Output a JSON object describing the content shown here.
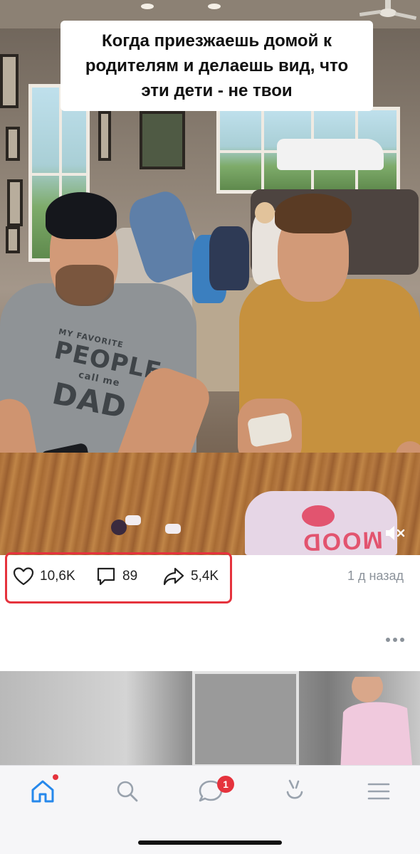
{
  "post": {
    "caption": "Когда приезжаешь домой к\nродителям и делаешь вид, что\nэти дети - не твои",
    "shirt_print": [
      "MY FAVORITE",
      "PEOPLE",
      "call me",
      "DAD"
    ],
    "bag_text": "MOOD",
    "actions": {
      "like_icon": "heart-icon",
      "like_count": "10,6K",
      "comment_icon": "comment-icon",
      "comment_count": "89",
      "share_icon": "share-arrow-icon",
      "share_count": "5,4K"
    },
    "timestamp": "1 д назад",
    "mute_icon": "speaker-muted-icon",
    "more_icon": "more-dots-icon"
  },
  "bottom_nav": {
    "items": [
      {
        "icon": "home-icon",
        "active": true,
        "dot": true
      },
      {
        "icon": "search-icon",
        "active": false
      },
      {
        "icon": "messages-icon",
        "active": false,
        "badge": "1"
      },
      {
        "icon": "clips-icon",
        "active": false
      },
      {
        "icon": "menu-icon",
        "active": false
      }
    ]
  },
  "colors": {
    "accent": "#2688eb",
    "badge": "#e5333d",
    "highlight_box": "#e5333d",
    "muted_text": "#8b929a"
  }
}
